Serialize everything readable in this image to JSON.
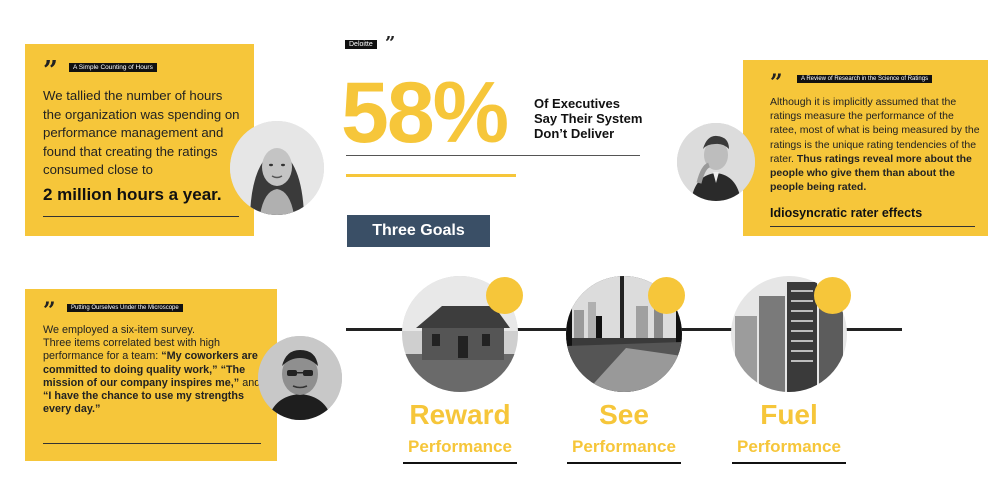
{
  "colors": {
    "accent": "#f6c63a",
    "dark_button": "#3a4f66",
    "text": "#111111"
  },
  "card_hours": {
    "tag": "A Simple Counting of Hours",
    "body": "We tallied the number of hours the organization was spending on performance management and found that creating the ratings consumed close to",
    "highlight": "2 million hours a year."
  },
  "card_research": {
    "tag": "A Review of Research in the Science of Ratings",
    "body": "Although it is implicitly assumed that the ratings measure the performance of the ratee, most of what is being measured by the ratings is the unique rating tendencies of the rater.",
    "bold": "Thus ratings reveal more about the people who give them than about the people being rated.",
    "highlight": "Idiosyncratic rater effects"
  },
  "card_survey": {
    "tag": "Putting Ourselves Under the Microscope",
    "line1": "We employed a six-item survey.",
    "line2": "Three items correlated best with high performance for a team:",
    "q1": "“My coworkers are committed to doing quality work,”",
    "q2": "“The mission of our company inspires me,”",
    "and": "and",
    "q3": "“I have the chance to use my strengths every day.”"
  },
  "stat": {
    "source": "Deloitte",
    "value": "58%",
    "caption_line1": "Of Executives",
    "caption_line2": "Say Their System",
    "caption_line3": "Don’t Deliver"
  },
  "goals": {
    "title": "Three Goals",
    "items": [
      {
        "word": "Reward",
        "sub": "Performance",
        "image": "abandoned-farmhouse-photo"
      },
      {
        "word": "See",
        "sub": "Performance",
        "image": "office-window-skyline-photo"
      },
      {
        "word": "Fuel",
        "sub": "Performance",
        "image": "city-skyscrapers-photo"
      }
    ]
  },
  "icons": {
    "quote": "quote-mark-icon",
    "avatars": [
      "woman-portrait",
      "man-thinking-portrait",
      "man-glasses-portrait"
    ]
  }
}
